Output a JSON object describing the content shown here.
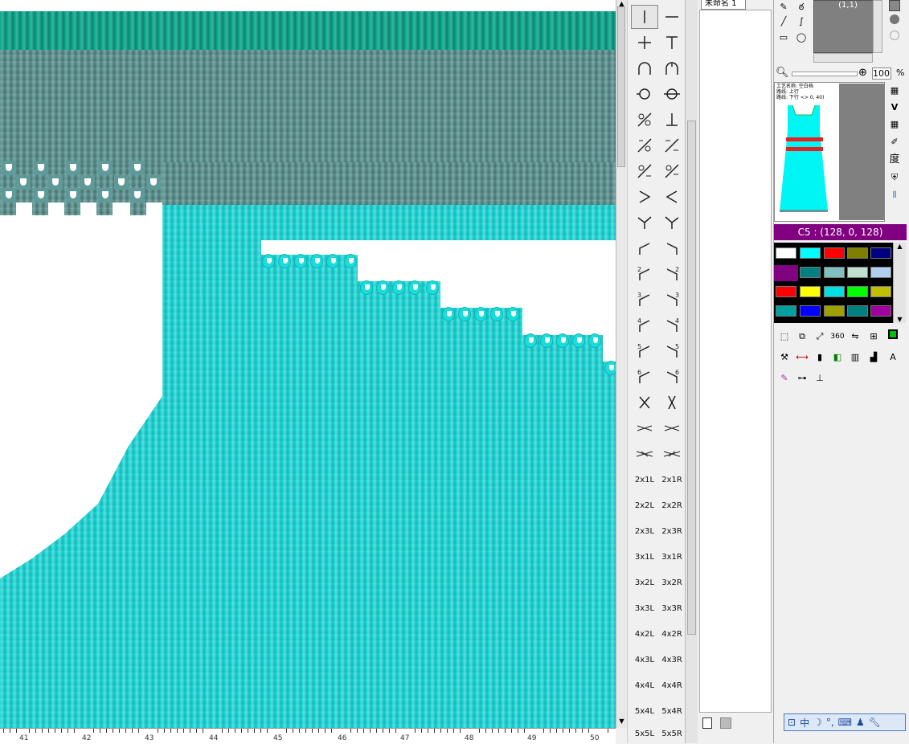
{
  "file_tab": {
    "label": "未命名 1"
  },
  "coordinate_display": "(1,1)",
  "zoom": {
    "value": "100",
    "unit": "%"
  },
  "current_color": {
    "label": "C5 : (128, 0, 128)",
    "hex": "#800080"
  },
  "ruler": {
    "labels": [
      "41",
      "42",
      "43",
      "44",
      "45",
      "46",
      "47",
      "48",
      "49",
      "50"
    ]
  },
  "stitches": {
    "labels": [
      "2x1L",
      "2x1R",
      "2x2L",
      "2x2R",
      "2x3L",
      "2x3R",
      "3x1L",
      "3x1R",
      "3x2L",
      "3x2R",
      "3x3L",
      "3x3R",
      "4x2L",
      "4x2R",
      "4x3L",
      "4x3R",
      "4x4L",
      "4x4R",
      "5x4L",
      "5x4R",
      "5x5L",
      "5x5R"
    ],
    "numbered": [
      "2",
      "2",
      "3",
      "3",
      "4",
      "4",
      "5",
      "5",
      "6",
      "6"
    ]
  },
  "palette": {
    "colors": [
      "#ffffff",
      "#00ffff",
      "#ff0000",
      "#808000",
      "#000080",
      "#800080",
      "#008080",
      "#80c0c0",
      "#c0e0d0",
      "#b0d0f0",
      "#ff0000",
      "#ffff00",
      "#00e0e0",
      "#00ff00",
      "#c0c000",
      "#00a0a0",
      "#0000ff",
      "#a0a000",
      "#008080",
      "#a000a0"
    ]
  },
  "garment_preview": {
    "header_lines": [
      "工艺名称: 空白档",
      "路线: 上行",
      "路线: 下行 <> 0, 40)"
    ]
  },
  "ime_toolbar": {
    "lang": "中"
  },
  "colors": {
    "teal_knit": "#5f9a98",
    "cyan_knit": "#19dcdc",
    "green_rib": "#0aa58b"
  }
}
